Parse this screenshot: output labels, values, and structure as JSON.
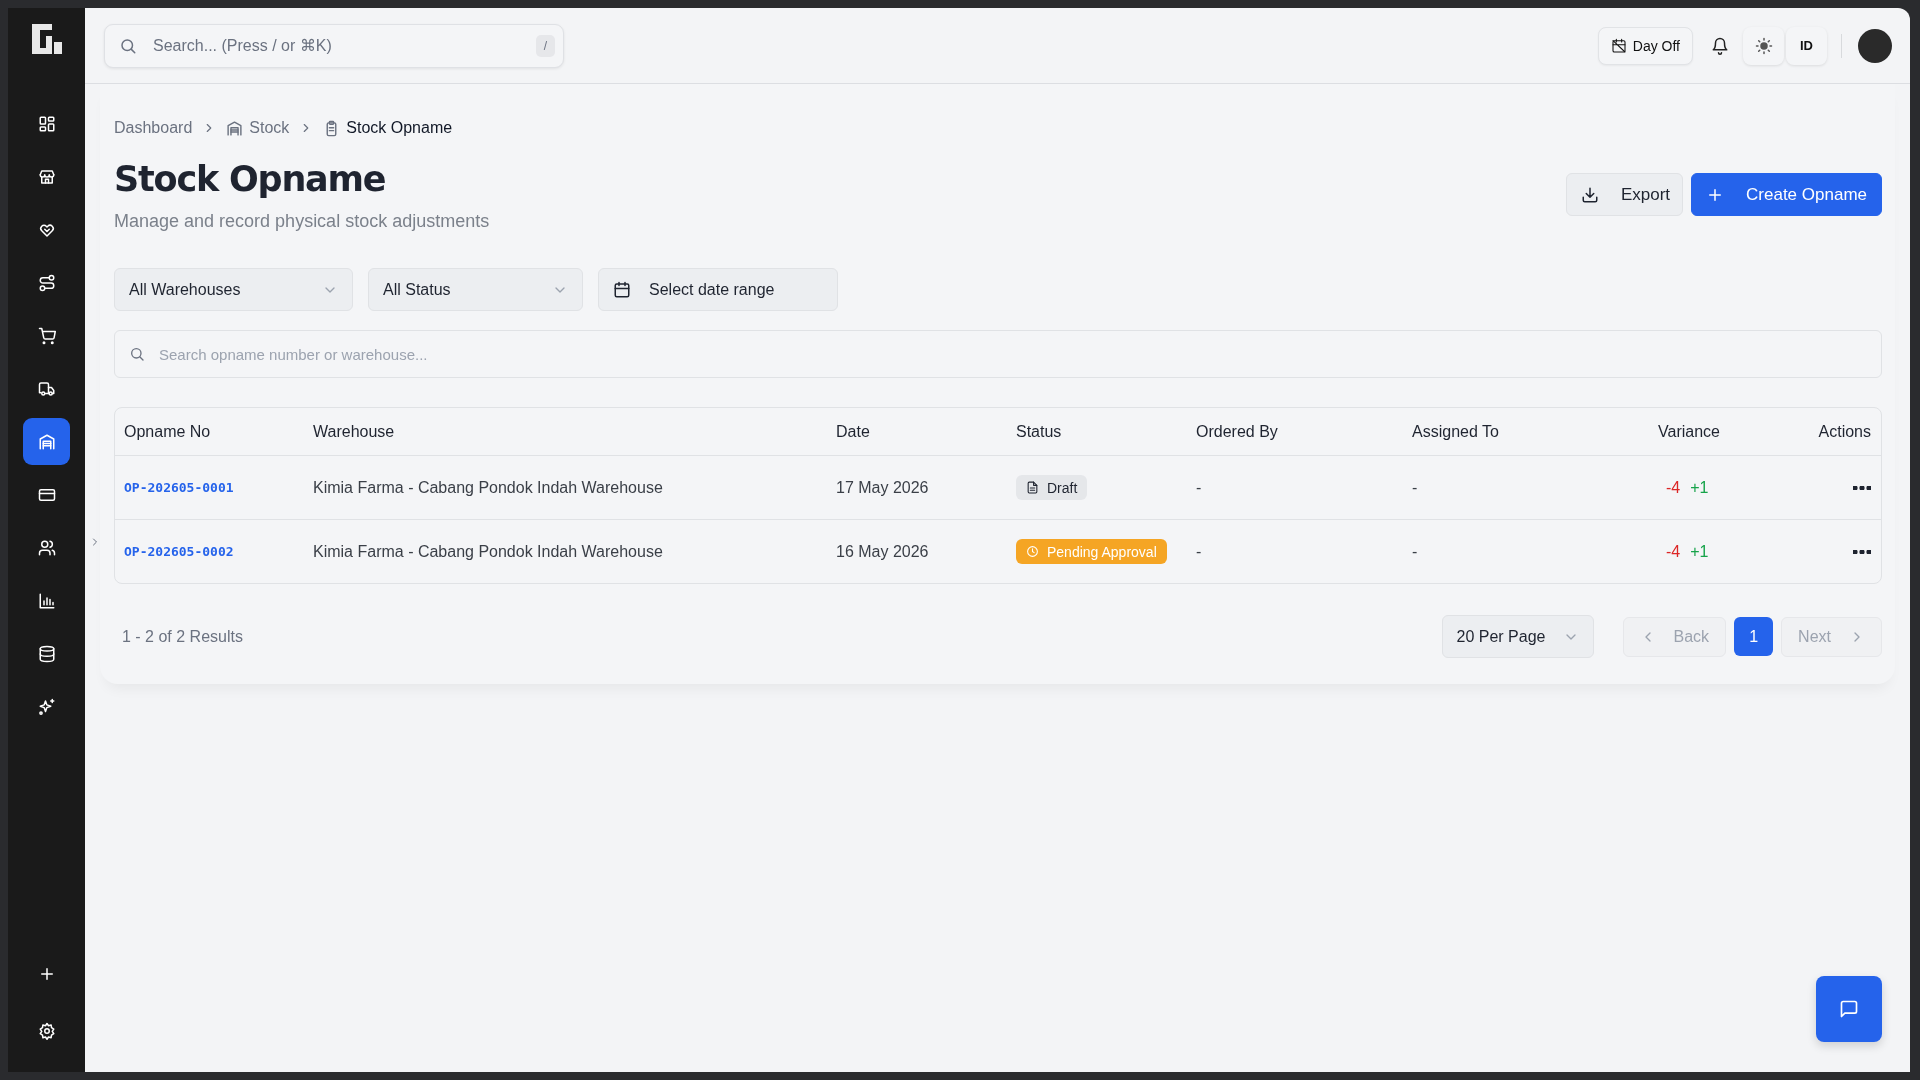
{
  "sidebar": {
    "items": [
      {
        "selected": false
      },
      {
        "selected": false
      },
      {
        "selected": false
      },
      {
        "selected": false
      },
      {
        "selected": false
      },
      {
        "selected": false
      },
      {
        "selected": true
      },
      {
        "selected": false
      },
      {
        "selected": false
      },
      {
        "selected": false
      },
      {
        "selected": false
      },
      {
        "selected": false
      }
    ]
  },
  "topbar": {
    "search": {
      "placeholder": "Search... (Press / or ⌘K)",
      "shortcut": "/"
    },
    "day_off": "Day Off",
    "language": "ID"
  },
  "breadcrumb": [
    "Dashboard",
    "Stock",
    "Stock Opname"
  ],
  "page": {
    "title": "Stock Opname",
    "subtitle": "Manage and record physical stock adjustments",
    "export": "Export",
    "create": "Create Opname"
  },
  "filters": {
    "warehouse": "All Warehouses",
    "status": "All Status",
    "date": "Select date range"
  },
  "search": {
    "placeholder": "Search opname number or warehouse..."
  },
  "table": {
    "columns": [
      "Opname No",
      "Warehouse",
      "Date",
      "Status",
      "Ordered By",
      "Assigned To",
      "Variance",
      "Actions"
    ],
    "rows": [
      {
        "number": "OP-202605-0001",
        "warehouse": "Kimia Farma - Cabang Pondok Indah Warehouse",
        "date": "17 May 2026",
        "status": {
          "kind": "draft",
          "label": "Draft"
        },
        "ordered_by": "-",
        "assigned_to": "-",
        "variance_minus": "-4",
        "variance_plus": "+1"
      },
      {
        "number": "OP-202605-0002",
        "warehouse": "Kimia Farma - Cabang Pondok Indah Warehouse",
        "date": "16 May 2026",
        "status": {
          "kind": "pending",
          "label": "Pending Approval"
        },
        "ordered_by": "-",
        "assigned_to": "-",
        "variance_minus": "-4",
        "variance_plus": "+1"
      }
    ]
  },
  "pagination": {
    "summary": "1 - 2 of 2 Results",
    "per_page": "20 Per Page",
    "back": {
      "label": "Back",
      "disabled": true
    },
    "pages": [
      {
        "label": "1",
        "selected": true
      }
    ],
    "next": {
      "label": "Next",
      "disabled": true
    }
  }
}
